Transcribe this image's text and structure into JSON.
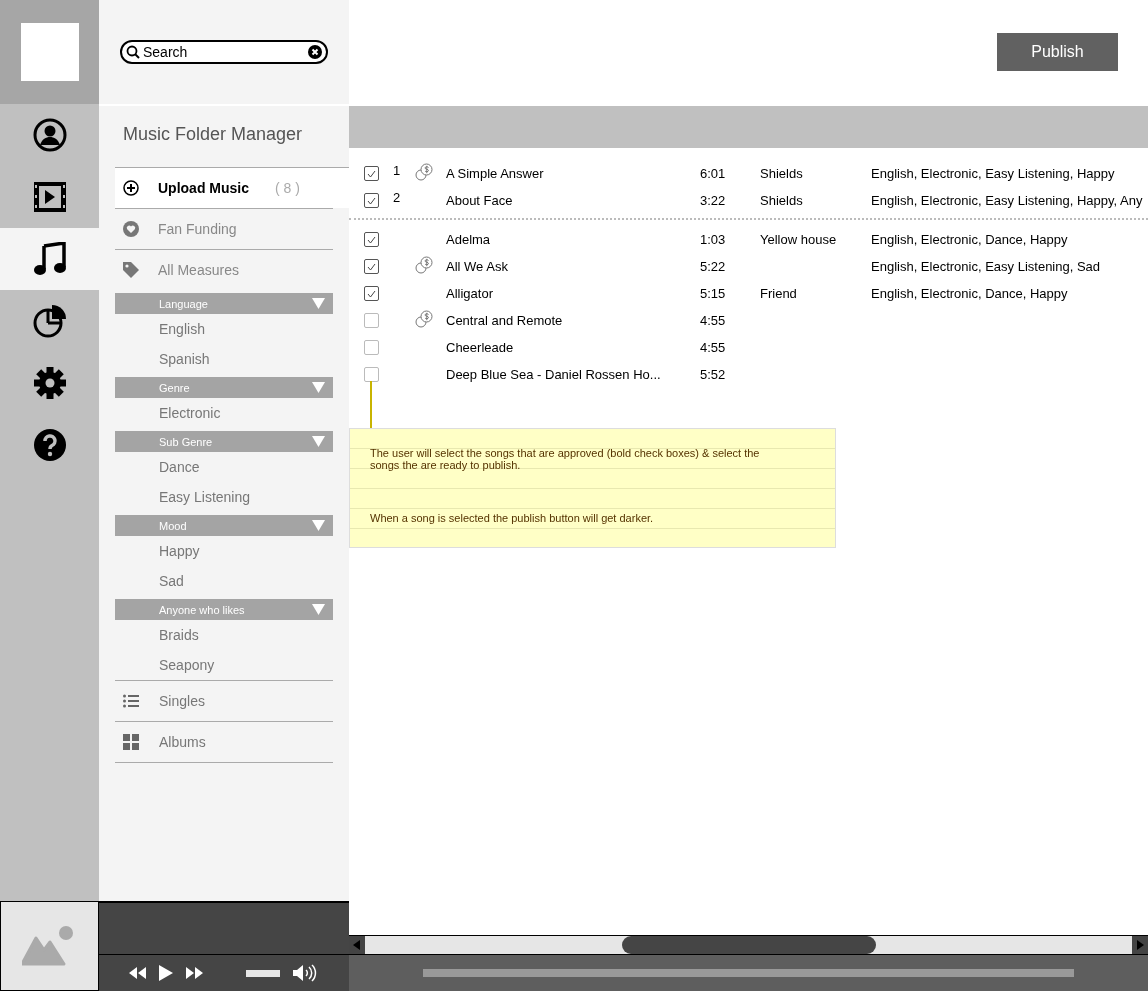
{
  "rail": {
    "items": [
      {
        "kind": "user",
        "selected": false
      },
      {
        "kind": "video",
        "selected": false
      },
      {
        "kind": "music",
        "selected": true
      },
      {
        "kind": "chart",
        "selected": false
      },
      {
        "kind": "settings",
        "selected": false
      },
      {
        "kind": "help",
        "selected": false
      }
    ]
  },
  "search": {
    "placeholder": "Search"
  },
  "sidebar": {
    "title": "Music Folder Manager",
    "menu": [
      {
        "kind": "upload",
        "label": "Upload Music",
        "count": "( 8 )",
        "selected": true
      },
      {
        "kind": "heart",
        "label": "Fan Funding",
        "selected": false
      },
      {
        "kind": "tag",
        "label": "All Measures",
        "selected": false
      }
    ],
    "filters": [
      {
        "heading": "Language",
        "items": [
          "English",
          "Spanish"
        ]
      },
      {
        "heading": "Genre",
        "items": [
          "Electronic"
        ]
      },
      {
        "heading": "Sub Genre",
        "items": [
          "Dance",
          "Easy Listening"
        ]
      },
      {
        "heading": "Mood",
        "items": [
          "Happy",
          "Sad"
        ]
      },
      {
        "heading": "Anyone who likes",
        "items": [
          "Braids",
          "Seapony"
        ]
      }
    ],
    "views": [
      {
        "kind": "list",
        "label": "Singles"
      },
      {
        "kind": "grid",
        "label": "Albums"
      }
    ]
  },
  "publish_button": "Publish",
  "groups": [
    [
      {
        "checked": true,
        "number": "1",
        "funded": true,
        "title": "A Simple Answer",
        "duration": "6:01",
        "artist": "Shields",
        "tags": "English, Electronic, Easy Listening, Happy"
      },
      {
        "checked": true,
        "number": "2",
        "funded": false,
        "title": "About Face",
        "duration": "3:22",
        "artist": "Shields",
        "tags": "English, Electronic, Easy Listening, Happy, Any"
      }
    ],
    [
      {
        "checked": true,
        "funded": false,
        "title": "Adelma",
        "duration": "1:03",
        "artist": "Yellow house",
        "tags": "English, Electronic, Dance, Happy"
      },
      {
        "checked": true,
        "funded": true,
        "title": "All We Ask",
        "duration": "5:22",
        "tags": "English, Electronic, Easy Listening, Sad"
      },
      {
        "checked": true,
        "funded": false,
        "title": "Alligator",
        "duration": "5:15",
        "artist": "Friend",
        "tags": "English, Electronic, Dance, Happy"
      },
      {
        "checked": false,
        "funded": true,
        "title": "Central and Remote",
        "duration": "4:55"
      },
      {
        "checked": false,
        "funded": false,
        "title": "Cheerleade",
        "duration": "4:55"
      },
      {
        "checked": false,
        "funded": false,
        "title": "Deep Blue Sea - Daniel Rossen Ho...",
        "duration": "5:52"
      }
    ]
  ],
  "note": {
    "paragraphs": [
      "The user will select the songs that are approved (bold check boxes) & select the songs the are ready to publish.",
      "When a song is selected the publish button will get darker."
    ]
  }
}
